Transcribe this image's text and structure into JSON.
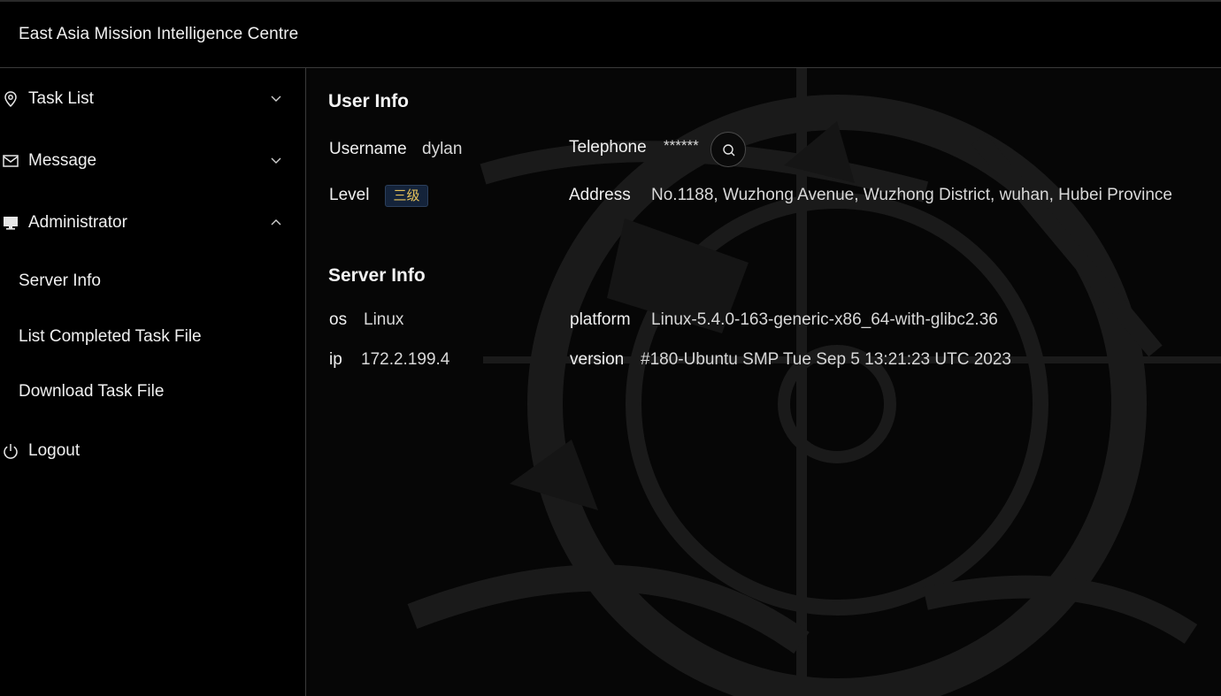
{
  "app": {
    "title": "East Asia Mission Intelligence Centre"
  },
  "sidebar": {
    "items": [
      {
        "label": "Task List",
        "icon": "location-pin-icon",
        "expanded": false
      },
      {
        "label": "Message",
        "icon": "mail-icon",
        "expanded": false
      },
      {
        "label": "Administrator",
        "icon": "monitor-icon",
        "expanded": true,
        "children": [
          "Server Info",
          "List Completed Task File",
          "Download Task File"
        ]
      },
      {
        "label": "Logout",
        "icon": "power-icon"
      }
    ]
  },
  "user_info": {
    "title": "User Info",
    "username_label": "Username",
    "username": "dylan",
    "telephone_label": "Telephone",
    "telephone": "******",
    "level_label": "Level",
    "level": "三级",
    "address_label": "Address",
    "address": "No.1188, Wuzhong Avenue, Wuzhong District, wuhan, Hubei Province"
  },
  "server_info": {
    "title": "Server Info",
    "os_label": "os",
    "os": "Linux",
    "platform_label": "platform",
    "platform": "Linux-5.4.0-163-generic-x86_64-with-glibc2.36",
    "ip_label": "ip",
    "ip": "172.2.199.4",
    "version_label": "version",
    "version": "#180-Ubuntu SMP Tue Sep 5 13:21:23 UTC 2023"
  },
  "colors": {
    "background": "#000000",
    "badge_bg": "#14233a",
    "badge_text": "#e7c35a"
  }
}
